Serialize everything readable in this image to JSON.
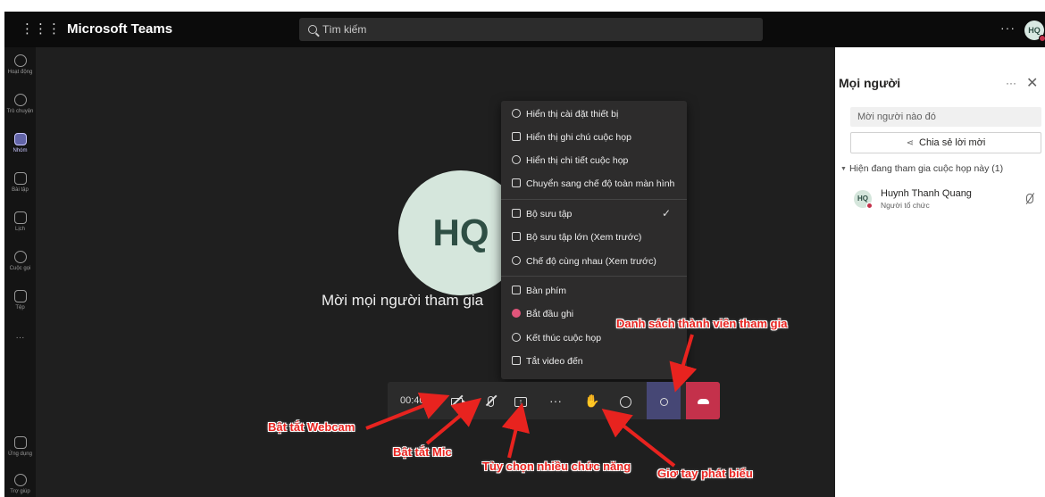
{
  "app": {
    "title": "Microsoft Teams",
    "search_placeholder": "Tìm kiếm",
    "avatar_initials": "HQ"
  },
  "rail": {
    "items": [
      {
        "label": "Hoạt động",
        "icon": "bell-icon"
      },
      {
        "label": "Trò chuyện",
        "icon": "chat-icon"
      },
      {
        "label": "Nhóm",
        "icon": "teams-icon"
      },
      {
        "label": "Bài tập",
        "icon": "assignments-icon"
      },
      {
        "label": "Lịch",
        "icon": "calendar-icon"
      },
      {
        "label": "Cuộc gọi",
        "icon": "phone-icon"
      },
      {
        "label": "Tệp",
        "icon": "file-icon"
      }
    ],
    "more": "···",
    "apps_label": "Ứng dụng",
    "help_label": "Trợ giúp"
  },
  "stage": {
    "avatar_initials": "HQ",
    "invite_text": "Mời mọi người tham gia"
  },
  "menu": {
    "items": [
      {
        "label": "Hiển thị cài đặt thiết bị",
        "icon": "gear-icon"
      },
      {
        "label": "Hiển thị ghi chú cuộc họp",
        "icon": "notes-icon"
      },
      {
        "label": "Hiển thị chi tiết cuộc họp",
        "icon": "info-icon"
      },
      {
        "label": "Chuyển sang chế độ toàn màn hình",
        "icon": "fullscreen-icon"
      },
      {
        "label": "Bộ sưu tập",
        "icon": "gallery-icon",
        "checked": true
      },
      {
        "label": "Bộ sưu tập lớn (Xem trước)",
        "icon": "large-gallery-icon"
      },
      {
        "label": "Chế độ cùng nhau (Xem trước)",
        "icon": "together-icon"
      },
      {
        "label": "Bàn phím",
        "icon": "keypad-icon"
      },
      {
        "label": "Bắt đầu ghi",
        "icon": "record-icon"
      },
      {
        "label": "Kết thúc cuộc họp",
        "icon": "end-call-icon"
      },
      {
        "label": "Tắt video đến",
        "icon": "video-off-icon"
      }
    ],
    "check_glyph": "✓"
  },
  "controls": {
    "timer": "00:40",
    "more_glyph": "···"
  },
  "panel": {
    "title": "Mọi người",
    "more_glyph": "···",
    "close_glyph": "✕",
    "invite_placeholder": "Mời người nào đó",
    "share_label": "Chia sẻ lời mời",
    "section_label": "Hiện đang tham gia cuộc họp này (1)",
    "participant": {
      "initials": "HQ",
      "name": "Huynh Thanh Quang",
      "role": "Người tổ chức"
    }
  },
  "annotations": {
    "webcam": "Bật tắt Webcam",
    "mic": "Bật tắt Mic",
    "more": "Tùy chọn nhiều chức năng",
    "hand": "Giơ tay phát biểu",
    "participants": "Danh sách thành viên tham gia",
    "color": "#e8231f"
  }
}
